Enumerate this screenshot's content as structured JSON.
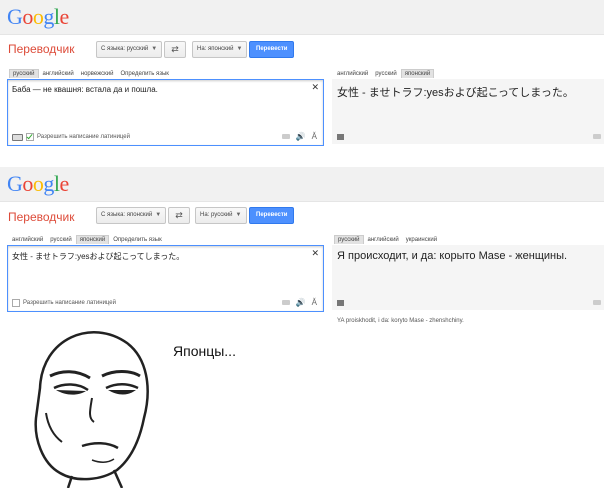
{
  "colors": {
    "accent": "#4d90fe",
    "title": "#dd4b39",
    "logo": [
      "#4285f4",
      "#ea4335",
      "#fbbc05",
      "#4285f4",
      "#34a853",
      "#ea4335"
    ]
  },
  "logo_letters": [
    "G",
    "o",
    "o",
    "g",
    "l",
    "e"
  ],
  "panels": [
    {
      "app_title": "Переводчик",
      "from_label": "С языка: русский",
      "to_label": "На: японский",
      "translate_label": "Перевести",
      "src_tabs": [
        "русский",
        "английский",
        "норвежский",
        "Определить язык"
      ],
      "src_tab_selected": 0,
      "source_text": "Баба — не квашня: встала да и пошла.",
      "latin_label": "Разрешить написание латиницей",
      "latin_checked": true,
      "tgt_tabs": [
        "английский",
        "русский",
        "японский"
      ],
      "tgt_tab_selected": 2,
      "translation": "女性 - ませトラフ:yesおよび起こってしまった。",
      "transliteration": ""
    },
    {
      "app_title": "Переводчик",
      "from_label": "С языка: японский",
      "to_label": "На: русский",
      "translate_label": "Перевести",
      "src_tabs": [
        "английский",
        "русский",
        "японский",
        "Определить язык"
      ],
      "src_tab_selected": 2,
      "source_text": "女性 - ませトラフ:yesおよび起こってしまった。",
      "latin_label": "Разрешить написание латиницей",
      "latin_checked": false,
      "tgt_tabs": [
        "русский",
        "английский",
        "украинский"
      ],
      "tgt_tab_selected": 0,
      "translation": "Я происходит, и да: корыто Mase - женщины.",
      "transliteration": "YA proiskhodit, i da: koryto Mase - zhenshchiny."
    }
  ],
  "caption": "Японцы..."
}
